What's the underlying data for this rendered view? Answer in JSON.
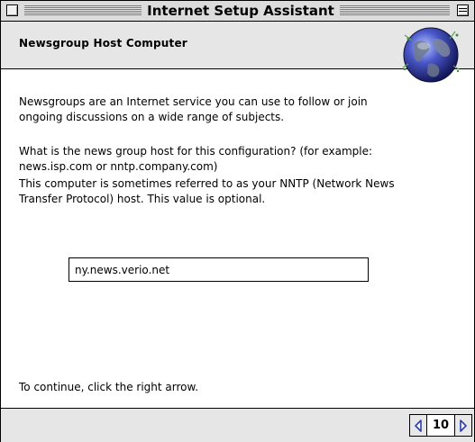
{
  "window": {
    "title": "Internet Setup Assistant"
  },
  "header": {
    "title": "Newsgroup Host Computer",
    "icon": "globe-icon"
  },
  "content": {
    "paragraph1": "Newsgroups are an Internet service you can use to follow or join ongoing discussions on a wide range of subjects.",
    "paragraph2": "What is the news group host for this configuration? (for example: news.isp.com or nntp.company.com)",
    "paragraph3": "This computer is sometimes referred to as your NNTP (Network News Transfer Protocol) host.  This value is optional.",
    "host_input_value": "ny.news.verio.net",
    "continue_text": "To continue, click the right arrow."
  },
  "navigation": {
    "page_number": "10",
    "prev_icon": "left-arrow-icon",
    "next_icon": "right-arrow-icon"
  },
  "colors": {
    "nav_arrow": "#2a3fb0",
    "header_band": "#e6e6e6",
    "titlebar": "#dcdcdc"
  }
}
